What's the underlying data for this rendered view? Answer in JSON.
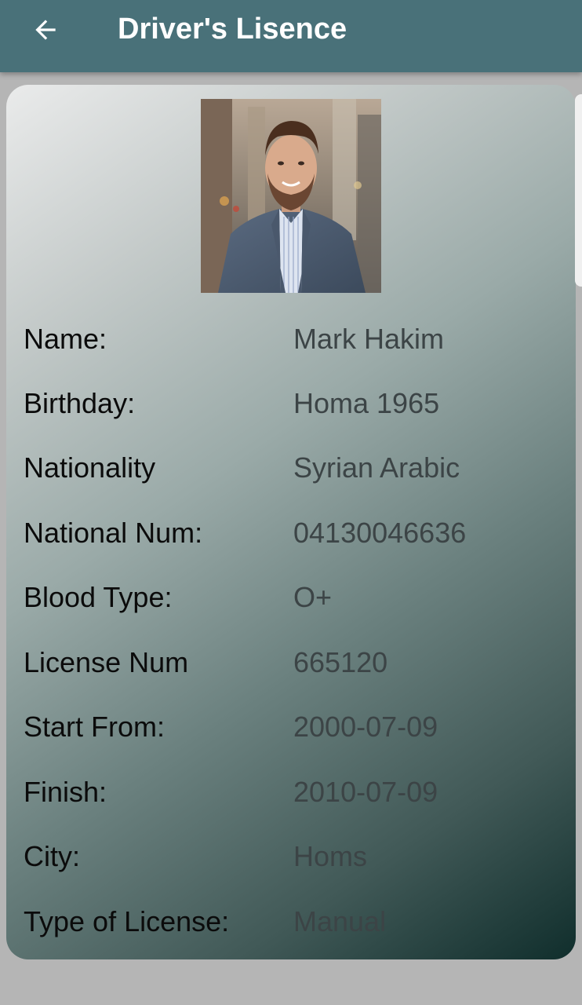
{
  "app_bar": {
    "title": "Driver's Lisence",
    "back_icon": "arrow-left-icon"
  },
  "colors": {
    "app_bar": "#497179",
    "background": "#b5b5b5",
    "label_text": "#0b0b0b",
    "value_text": "#3c4446"
  },
  "license": {
    "photo": "driver-photo",
    "fields": [
      {
        "label": "Name:",
        "value": "Mark Hakim"
      },
      {
        "label": "Birthday:",
        "value": "Homa 1965"
      },
      {
        "label": "Nationality",
        "value": "Syrian Arabic"
      },
      {
        "label": "National Num:",
        "value": "04130046636"
      },
      {
        "label": "Blood Type:",
        "value": "O+"
      },
      {
        "label": "License Num",
        "value": "665120"
      },
      {
        "label": "Start From:",
        "value": "2000-07-09"
      },
      {
        "label": "Finish:",
        "value": "2010-07-09"
      },
      {
        "label": "City:",
        "value": "Homs"
      },
      {
        "label": "Type of License:",
        "value": "Manual"
      }
    ]
  }
}
